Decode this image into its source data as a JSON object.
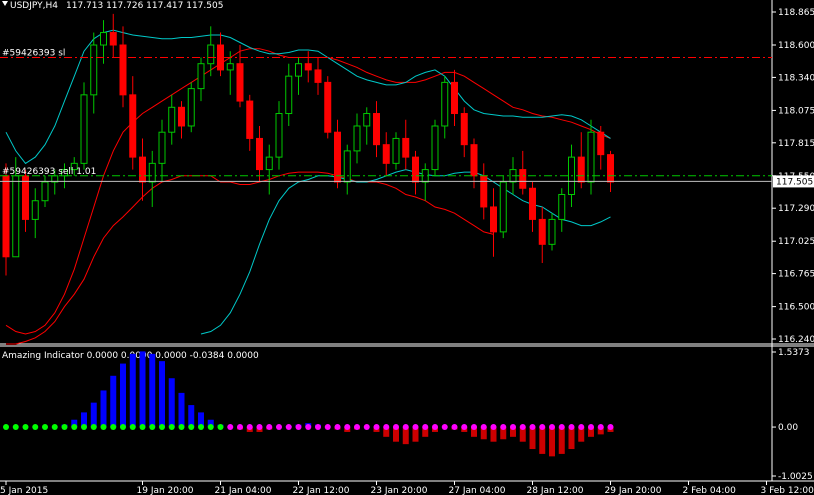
{
  "header": {
    "symbol": "USDJPY,H4",
    "ohlc": "117.713 117.726 117.417 117.505"
  },
  "price_axis": {
    "ticks": [
      {
        "label": "118.865",
        "value": 118.865
      },
      {
        "label": "118.600",
        "value": 118.6
      },
      {
        "label": "118.340",
        "value": 118.34
      },
      {
        "label": "118.075",
        "value": 118.075
      },
      {
        "label": "117.815",
        "value": 117.815
      },
      {
        "label": "117.550",
        "value": 117.55
      },
      {
        "label": "117.290",
        "value": 117.29
      },
      {
        "label": "117.025",
        "value": 117.025
      },
      {
        "label": "116.765",
        "value": 116.765
      },
      {
        "label": "116.500",
        "value": 116.5
      },
      {
        "label": "116.240",
        "value": 116.24
      }
    ],
    "current_price": "117.505",
    "current_value": 117.505
  },
  "orders": {
    "sl": {
      "label": "#59426393 sl",
      "value": 118.5
    },
    "sell": {
      "label": "#59426393 sell 1.01",
      "value": 117.55
    }
  },
  "indicator": {
    "title": "Amazing Indicator 0.0000 0.0000 0.0000 -0.0384 0.0000",
    "ticks": [
      {
        "label": "1.5373",
        "value": 1.5373
      },
      {
        "label": "0.00",
        "value": 0
      },
      {
        "label": "-1.0025",
        "value": -1.0025
      }
    ]
  },
  "time_axis": {
    "labels": [
      "5 Jan 2015",
      "19 Jan 20:00",
      "21 Jan 04:00",
      "22 Jan 12:00",
      "23 Jan 20:00",
      "27 Jan 04:00",
      "28 Jan 12:00",
      "29 Jan 20:00",
      "2 Feb 04:00",
      "3 Feb 12:00"
    ],
    "label_bars": [
      0,
      14,
      22,
      30,
      38,
      46,
      54,
      62,
      70,
      78
    ]
  },
  "colors": {
    "bull": "#00c800",
    "bear": "#ff0000",
    "grid_dash": "#00c800",
    "ma_red": "#ff0000",
    "ma_cyan": "#00c8c8",
    "ind_blue": "#0000ff",
    "ind_red": "#cc0000",
    "dot_green": "#00ff00",
    "dot_magenta": "#ff00ff"
  },
  "chart_data": {
    "type": "candlestick",
    "candles": [
      [
        117.55,
        117.65,
        116.75,
        116.9
      ],
      [
        116.9,
        117.7,
        116.9,
        117.55
      ],
      [
        117.55,
        117.6,
        117.1,
        117.2
      ],
      [
        117.2,
        117.45,
        117.05,
        117.35
      ],
      [
        117.35,
        117.55,
        117.3,
        117.5
      ],
      [
        117.5,
        117.6,
        117.4,
        117.55
      ],
      [
        117.55,
        117.65,
        117.45,
        117.6
      ],
      [
        117.6,
        117.7,
        117.55,
        117.65
      ],
      [
        117.65,
        118.3,
        117.6,
        118.2
      ],
      [
        118.2,
        118.7,
        118.05,
        118.6
      ],
      [
        118.6,
        118.8,
        118.45,
        118.7
      ],
      [
        118.7,
        118.85,
        118.5,
        118.6
      ],
      [
        118.6,
        118.75,
        118.1,
        118.2
      ],
      [
        118.2,
        118.35,
        117.6,
        117.7
      ],
      [
        117.7,
        117.85,
        117.35,
        117.5
      ],
      [
        117.5,
        117.75,
        117.3,
        117.65
      ],
      [
        117.65,
        118.0,
        117.5,
        117.9
      ],
      [
        117.9,
        118.2,
        117.8,
        118.1
      ],
      [
        118.1,
        118.15,
        117.85,
        117.95
      ],
      [
        117.95,
        118.3,
        117.9,
        118.25
      ],
      [
        118.25,
        118.5,
        118.15,
        118.45
      ],
      [
        118.45,
        118.75,
        118.35,
        118.6
      ],
      [
        118.6,
        118.7,
        118.35,
        118.4
      ],
      [
        118.4,
        118.55,
        118.2,
        118.45
      ],
      [
        118.45,
        118.6,
        118.1,
        118.15
      ],
      [
        118.15,
        118.2,
        117.75,
        117.85
      ],
      [
        117.85,
        117.95,
        117.5,
        117.6
      ],
      [
        117.6,
        117.8,
        117.4,
        117.7
      ],
      [
        117.7,
        118.15,
        117.6,
        118.05
      ],
      [
        118.05,
        118.45,
        117.95,
        118.35
      ],
      [
        118.35,
        118.5,
        118.2,
        118.45
      ],
      [
        118.45,
        118.55,
        118.3,
        118.4
      ],
      [
        118.4,
        118.5,
        118.2,
        118.3
      ],
      [
        118.3,
        118.35,
        117.85,
        117.9
      ],
      [
        117.9,
        118.0,
        117.45,
        117.5
      ],
      [
        117.5,
        117.8,
        117.4,
        117.75
      ],
      [
        117.75,
        118.05,
        117.65,
        117.95
      ],
      [
        117.95,
        118.1,
        117.8,
        118.05
      ],
      [
        118.05,
        118.15,
        117.7,
        117.8
      ],
      [
        117.8,
        117.9,
        117.55,
        117.65
      ],
      [
        117.65,
        117.9,
        117.6,
        117.85
      ],
      [
        117.85,
        118.0,
        117.6,
        117.7
      ],
      [
        117.7,
        117.75,
        117.4,
        117.5
      ],
      [
        117.5,
        117.65,
        117.35,
        117.6
      ],
      [
        117.6,
        118.0,
        117.55,
        117.95
      ],
      [
        117.95,
        118.35,
        117.85,
        118.3
      ],
      [
        118.3,
        118.4,
        117.95,
        118.05
      ],
      [
        118.05,
        118.1,
        117.7,
        117.8
      ],
      [
        117.8,
        117.85,
        117.45,
        117.55
      ],
      [
        117.55,
        117.65,
        117.2,
        117.3
      ],
      [
        117.3,
        117.45,
        116.9,
        117.1
      ],
      [
        117.1,
        117.55,
        117.05,
        117.5
      ],
      [
        117.5,
        117.7,
        117.4,
        117.6
      ],
      [
        117.6,
        117.75,
        117.4,
        117.45
      ],
      [
        117.45,
        117.5,
        117.1,
        117.2
      ],
      [
        117.2,
        117.3,
        116.85,
        117.0
      ],
      [
        117.0,
        117.25,
        116.95,
        117.2
      ],
      [
        117.2,
        117.45,
        117.1,
        117.4
      ],
      [
        117.4,
        117.8,
        117.3,
        117.7
      ],
      [
        117.7,
        117.9,
        117.45,
        117.5
      ],
      [
        117.5,
        118.0,
        117.4,
        117.9
      ],
      [
        117.9,
        117.95,
        117.6,
        117.72
      ],
      [
        117.72,
        117.75,
        117.42,
        117.5
      ]
    ],
    "ma_red": [
      116.35,
      116.3,
      116.28,
      116.3,
      116.35,
      116.45,
      116.6,
      116.8,
      117.05,
      117.3,
      117.55,
      117.75,
      117.9,
      117.98,
      118.05,
      118.1,
      118.15,
      118.2,
      118.25,
      118.3,
      118.35,
      118.4,
      118.45,
      118.5,
      118.55,
      118.57,
      118.57,
      118.55,
      118.52,
      118.5,
      118.5,
      118.5,
      118.5,
      118.5,
      118.48,
      118.45,
      118.42,
      118.38,
      118.35,
      118.32,
      118.3,
      118.3,
      118.3,
      118.32,
      118.35,
      118.38,
      118.38,
      118.35,
      118.3,
      118.25,
      118.2,
      118.15,
      118.1,
      118.08,
      118.05,
      118.03,
      118.02,
      118.0,
      117.98,
      117.95,
      117.92,
      117.88,
      117.85
    ],
    "ma_cyan": [
      117.9,
      117.75,
      117.65,
      117.7,
      117.8,
      117.95,
      118.15,
      118.35,
      118.55,
      118.65,
      118.7,
      118.72,
      118.7,
      118.68,
      118.67,
      118.66,
      118.65,
      118.65,
      118.66,
      118.66,
      118.67,
      118.68,
      118.68,
      118.66,
      118.62,
      118.58,
      118.55,
      118.53,
      118.53,
      118.54,
      118.56,
      118.56,
      118.55,
      118.5,
      118.45,
      118.4,
      118.35,
      118.32,
      118.3,
      118.28,
      118.28,
      118.3,
      118.35,
      118.38,
      118.4,
      118.35,
      118.25,
      118.15,
      118.08,
      118.05,
      118.04,
      118.03,
      118.03,
      118.02,
      118.02,
      118.02,
      118.03,
      118.04,
      118.03,
      118.0,
      117.95,
      117.9,
      117.85
    ],
    "ma_red_low": [
      116.2,
      116.2,
      116.22,
      116.25,
      116.3,
      116.38,
      116.5,
      116.6,
      116.72,
      116.9,
      117.05,
      117.15,
      117.22,
      117.3,
      117.38,
      117.45,
      117.5,
      117.52,
      117.55,
      117.55,
      117.55,
      117.55,
      117.5,
      117.5,
      117.48,
      117.48,
      117.5,
      117.52,
      117.55,
      117.57,
      117.58,
      117.58,
      117.58,
      117.57,
      117.55,
      117.53,
      117.5,
      117.5,
      117.5,
      117.48,
      117.45,
      117.4,
      117.38,
      117.35,
      117.3,
      117.28,
      117.25,
      117.2,
      117.15,
      117.1,
      117.08
    ],
    "ma_cyan_low": [
      116.28,
      116.3,
      116.35,
      116.45,
      116.6,
      116.78,
      117.0,
      117.2,
      117.35,
      117.45,
      117.5,
      117.52,
      117.55,
      117.55,
      117.54,
      117.52,
      117.5,
      117.5,
      117.52,
      117.55,
      117.58,
      117.6,
      117.58,
      117.56,
      117.55,
      117.55,
      117.57,
      117.58,
      117.58,
      117.55,
      117.5,
      117.45,
      117.4,
      117.35,
      117.32,
      117.3,
      117.25,
      117.2,
      117.18,
      117.15,
      117.15,
      117.18,
      117.22
    ],
    "indicator_bars": [
      0,
      0,
      0,
      0,
      0,
      0,
      0.05,
      0.15,
      0.3,
      0.5,
      0.75,
      1.05,
      1.3,
      1.5,
      1.55,
      1.5,
      1.35,
      1.0,
      0.7,
      0.45,
      0.3,
      0.15,
      0.05,
      0,
      -0.05,
      -0.1,
      -0.1,
      -0.05,
      0,
      0.02,
      0.05,
      0.08,
      0.05,
      0,
      -0.05,
      -0.1,
      -0.05,
      0,
      -0.1,
      -0.2,
      -0.3,
      -0.35,
      -0.3,
      -0.2,
      -0.1,
      0,
      -0.05,
      -0.1,
      -0.2,
      -0.25,
      -0.3,
      -0.25,
      -0.2,
      -0.3,
      -0.45,
      -0.55,
      -0.6,
      -0.55,
      -0.45,
      -0.3,
      -0.2,
      -0.15,
      -0.1
    ],
    "indicator_dot_split": 23
  }
}
